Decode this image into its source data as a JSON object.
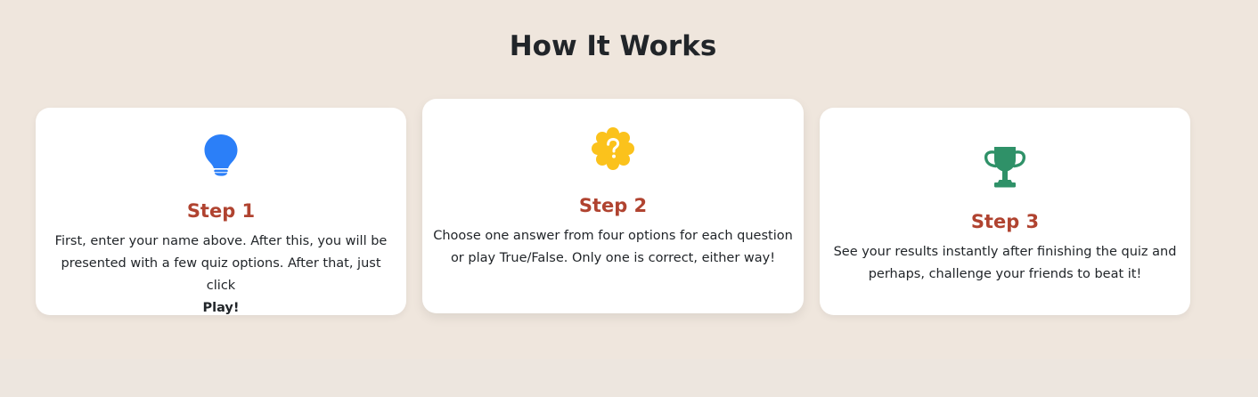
{
  "section": {
    "title": "How It Works"
  },
  "steps": [
    {
      "icon": "lightbulb-icon",
      "color": "#2b7ff8",
      "title": "Step 1",
      "desc": "First, enter your name above. After this, you will be presented with a few quiz options. After that, just click",
      "desc_bold": "Play!"
    },
    {
      "icon": "question-badge-icon",
      "color": "#fbc21c",
      "title": "Step 2",
      "desc": "Choose one answer from four options for each question or play True/False. Only one is correct, either way!"
    },
    {
      "icon": "trophy-icon",
      "color": "#2f9168",
      "title": "Step 3",
      "desc": "See your results instantly after finishing the quiz and perhaps, challenge your friends to beat it!"
    }
  ],
  "colors": {
    "background": "#efe6dd",
    "step_title": "#b04330",
    "card": "#ffffff"
  }
}
